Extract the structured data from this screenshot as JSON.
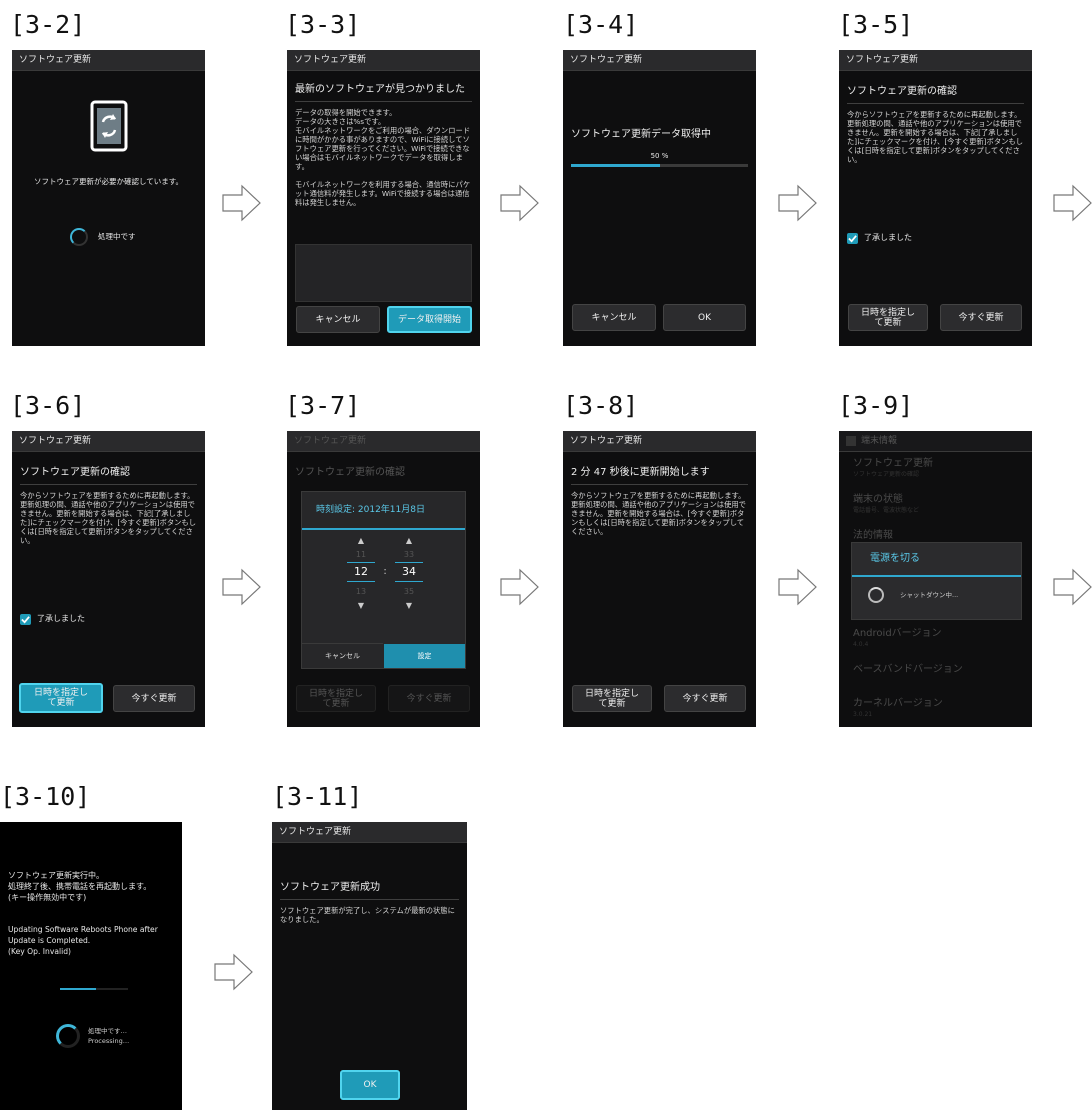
{
  "labels": {
    "s2": "[3-2]",
    "s3": "[3-3]",
    "s4": "[3-4]",
    "s5": "[3-5]",
    "s6": "[3-6]",
    "s7": "[3-7]",
    "s8": "[3-8]",
    "s9": "[3-9]",
    "s10": "[3-10]",
    "s11": "[3-11]"
  },
  "app_title": "ソフトウェア更新",
  "screen2": {
    "message": "ソフトウェア更新が必要か確認しています。",
    "processing": "処理中です",
    "icon": "phone-update-icon"
  },
  "screen3": {
    "heading": "最新のソフトウェアが見つかりました",
    "body1": "データの取得を開始できます。\nデータの大きさは%sです。\nモバイルネットワークをご利用の場合、ダウンロードに時間がかかる事がありますので、WiFiに接続してソフトウェア更新を行ってください。WiFiで接続できない場合はモバイルネットワークでデータを取得します。",
    "body2": "モバイルネットワークを利用する場合、通信時にパケット通信料が発生します。WiFiで接続する場合は通信料は発生しません。",
    "cancel": "キャンセル",
    "start": "データ取得開始"
  },
  "screen4": {
    "heading": "ソフトウェア更新データ取得中",
    "percent": "50 %",
    "progress": 0.5,
    "cancel": "キャンセル",
    "ok": "OK"
  },
  "confirm": {
    "heading": "ソフトウェア更新の確認",
    "body": "今からソフトウェアを更新するために再起動します。更新処理の間、通話や他のアプリケーションは使用できません。更新を開始する場合は、下記[了承しました]にチェックマークを付け、[今すぐ更新]ボタンもしくは[日時を指定して更新]ボタンをタップしてください。",
    "agree": "了承しました",
    "schedule": "日時を指定し\nて更新",
    "now": "今すぐ更新"
  },
  "screen7": {
    "dialog_title": "時刻設定: 2012年11月8日",
    "hour_prev": "11",
    "hour": "12",
    "hour_next": "13",
    "min_prev": "33",
    "min": "34",
    "min_next": "35",
    "colon": ":",
    "cancel": "キャンセル",
    "set": "設定"
  },
  "screen8": {
    "heading": "2 分 47 秒後に更新開始します",
    "body": "今からソフトウェアを更新するために再起動します。更新処理の間、通話や他のアプリケーションは使用できません。更新を開始する場合は、[今すぐ更新]ボタンもしくは[日時を指定して更新]ボタンをタップしてください。",
    "schedule": "日時を指定し\nて更新",
    "now": "今すぐ更新"
  },
  "screen9": {
    "titlebar": "端末情報",
    "item1": "ソフトウェア更新",
    "item1_sub": "ソフトウェア更新の確認",
    "item2": "端末の状態",
    "item2_sub": "電話番号、電波状態など",
    "item3": "法的情報",
    "dialog_title": "電源を切る",
    "dialog_msg": "シャットダウン中...",
    "item4": "Androidバージョン",
    "item4_sub": "4.0.4",
    "item5": "ベースバンドバージョン",
    "item6": "カーネルバージョン",
    "item6_sub": "3.0.21"
  },
  "screen10": {
    "jp1": "ソフトウェア更新実行中。",
    "jp2": "処理終了後、携帯電話を再起動します。",
    "jp3": "(キー操作無効中です)",
    "en1": "Updating Software Reboots Phone after",
    "en2": "Update is Completed.",
    "en3": "(Key Op. Invalid)",
    "proc_jp": "処理中です…",
    "proc_en": "Processing…"
  },
  "screen11": {
    "heading": "ソフトウェア更新成功",
    "body": "ソフトウェア更新が完了し、システムが最新の状態になりました。",
    "ok": "OK"
  },
  "colors": {
    "accent": "#1f9bb8",
    "accent_border": "#50d4ee",
    "background": "#0e0e0f"
  }
}
